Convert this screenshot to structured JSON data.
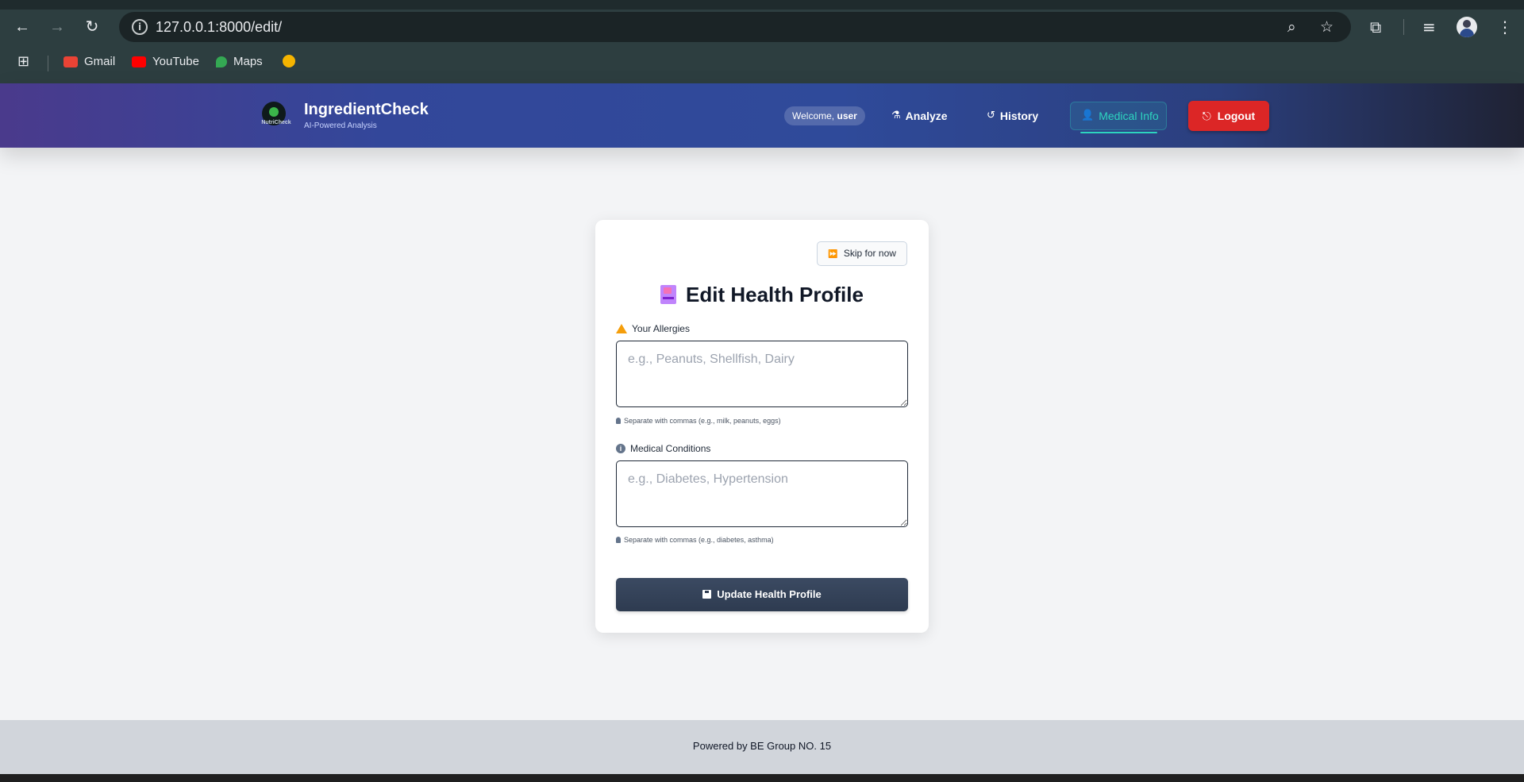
{
  "browser": {
    "url": "127.0.0.1:8000/edit/",
    "bookmarks": [
      {
        "label": "Gmail",
        "color": "#ea4335"
      },
      {
        "label": "YouTube",
        "color": "#ff0000"
      },
      {
        "label": "Maps",
        "color": "#34a853"
      }
    ]
  },
  "header": {
    "brand_title": "IngredientCheck",
    "brand_subtitle": "AI-Powered Analysis",
    "logo_text": "NutriCheck",
    "welcome_prefix": "Welcome,",
    "welcome_user": "user",
    "nav": {
      "analyze": "Analyze",
      "history": "History",
      "medical_info": "Medical Info",
      "logout": "Logout"
    },
    "active_color": "#2dd4bf",
    "logout_color": "#dc2626"
  },
  "card": {
    "skip_label": "Skip for now",
    "title": "Edit Health Profile",
    "allergies": {
      "label": "Your Allergies",
      "placeholder": "e.g., Peanuts, Shellfish, Dairy",
      "hint": "Separate with commas (e.g., milk, peanuts, eggs)"
    },
    "conditions": {
      "label": "Medical Conditions",
      "placeholder": "e.g., Diabetes, Hypertension",
      "hint": "Separate with commas (e.g., diabetes, asthma)"
    },
    "submit_label": "Update Health Profile"
  },
  "footer": {
    "text": "Powered by BE Group NO. 15"
  }
}
